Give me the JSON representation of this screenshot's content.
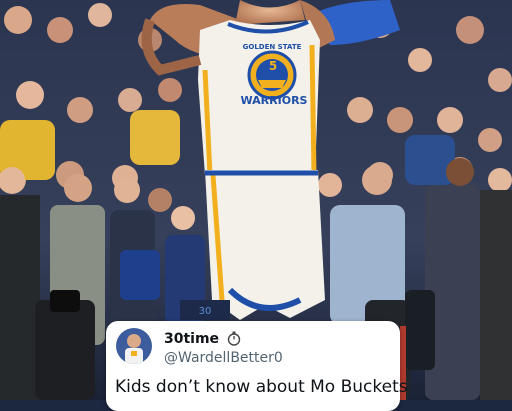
{
  "photo": {
    "description_icon": "basketball-player-celebration-photo",
    "jersey": {
      "team": "GOLDEN STATE",
      "name": "WARRIORS",
      "number": "5"
    },
    "colors": {
      "jersey": "#f3f1ea",
      "trim": "#f2b01e",
      "blue": "#1f4fa8",
      "crowd": "#27324e"
    }
  },
  "tweet_card": {
    "display_name": "30time",
    "badge_icon": "stopwatch-icon",
    "handle": "@WardellBetter0",
    "text": "Kids don’t know about Mo Buckets"
  }
}
